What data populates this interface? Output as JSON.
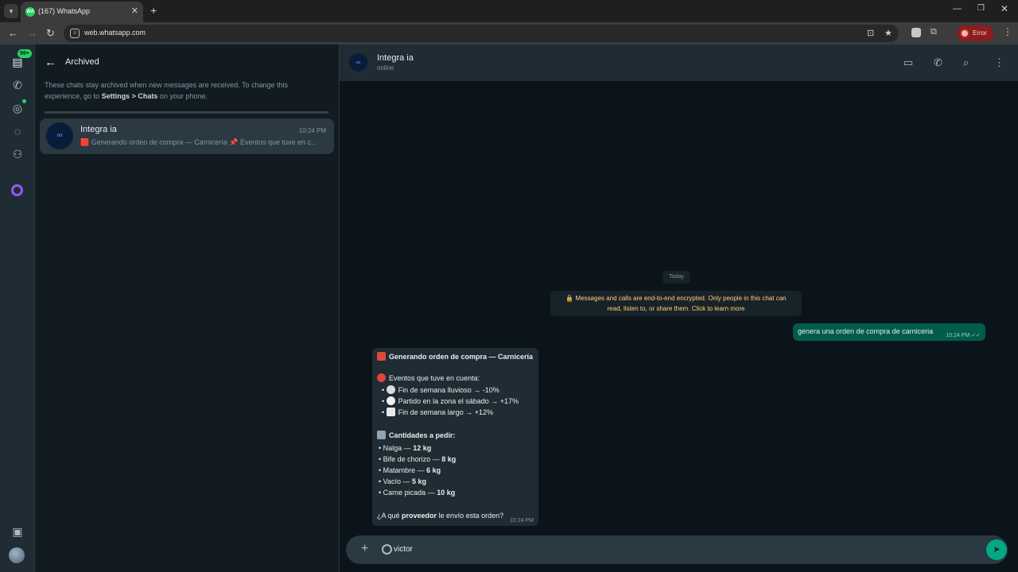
{
  "browser": {
    "tab_title": "(167) WhatsApp",
    "tab_favicon_text": "WA",
    "url": "web.whatsapp.com",
    "error_label": "Error"
  },
  "rail": {
    "chats_badge": "99+"
  },
  "sidebar": {
    "title": "Archived",
    "info_text_before": "These chats stay archived when new messages are received. To change this experience, go to ",
    "info_bold": "Settings > Chats",
    "info_text_after": " on your phone.",
    "chat": {
      "name": "Integra ia",
      "time": "10:24 PM",
      "preview": "🟥 Generando orden de compra — Carnicería 📌 Eventos que tuve en c..."
    }
  },
  "conversation": {
    "contact_name": "Integra ia",
    "contact_status": "online",
    "day_label": "Today",
    "encryption_line1": "🔒 Messages and calls are end-to-end encrypted. Only people in this chat can",
    "encryption_line2": "read, listen to, or share them. Click to learn more",
    "outgoing": {
      "text": "genera una orden de compra de carniceria",
      "time": "10:24 PM ✓✓"
    },
    "incoming": {
      "title": "Generando orden de compra — Carnicería",
      "events_header": "Eventos que tuve en cuenta:",
      "events": [
        "Fin de semana lluvioso → -10%",
        "Partido en la zona el sábado → +17%",
        "Fin de semana largo → +12%"
      ],
      "quantities_header": "Cantidades a pedir:",
      "items": [
        {
          "name": "Nalga — ",
          "qty": "12 kg"
        },
        {
          "name": "Bife de chorizo — ",
          "qty": "8 kg"
        },
        {
          "name": "Matambre — ",
          "qty": "6 kg"
        },
        {
          "name": "Vacío — ",
          "qty": "5 kg"
        },
        {
          "name": "Carne picada — ",
          "qty": "10 kg"
        }
      ],
      "question_prefix": "¿A qué ",
      "question_bold": "proveedor",
      "question_suffix": " le envío esta orden?",
      "time": "10:24 PM"
    },
    "compose_value": "victor"
  },
  "colors": {
    "accent": "#00a884",
    "outgoing_bubble": "#005c4b",
    "incoming_bubble": "#202c33",
    "error": "#8b1d1d"
  },
  "icons": {
    "tab_dropdown": "chevron-down-icon",
    "back": "arrow-left-icon",
    "video": "video-call-icon",
    "phone": "phone-icon",
    "search": "search-icon",
    "menu": "more-vertical-icon",
    "send": "send-icon"
  }
}
